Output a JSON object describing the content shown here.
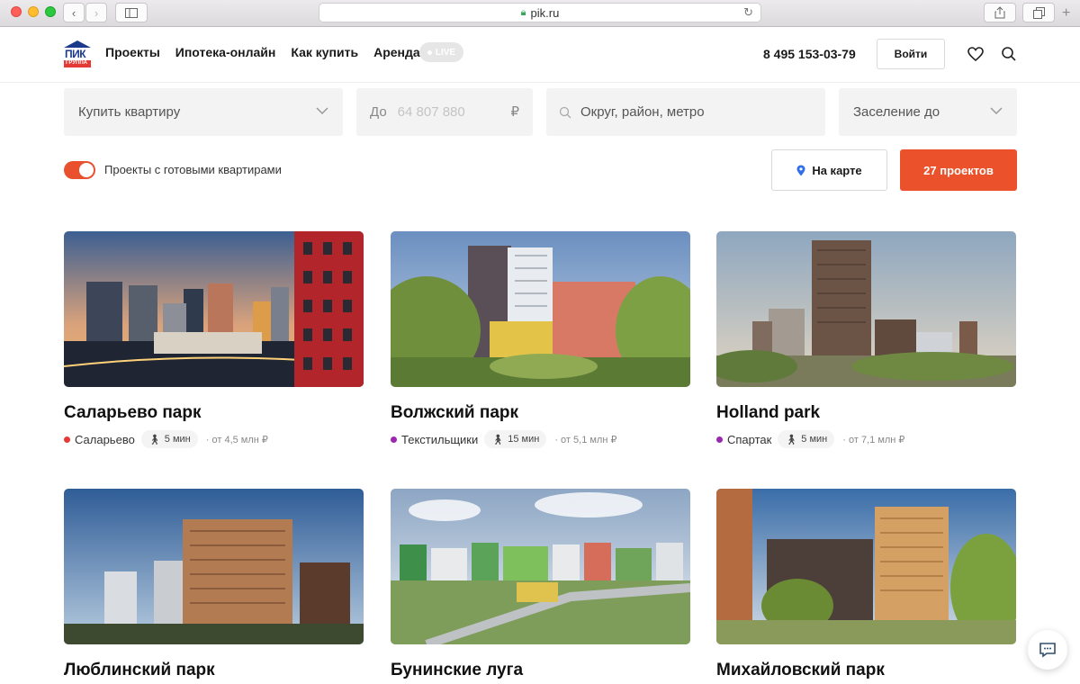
{
  "browser": {
    "url": "pik.ru"
  },
  "header": {
    "logo_top": "ПИК",
    "logo_bottom": "ГРУППА",
    "nav": [
      {
        "label": "Проекты"
      },
      {
        "label": "Ипотека-онлайн"
      },
      {
        "label": "Как купить"
      },
      {
        "label": "Аренда"
      }
    ],
    "live_label": "LIVE",
    "phone": "8 495 153-03-79",
    "login_label": "Войти"
  },
  "filters": {
    "type_select": "Купить квартиру",
    "price_prefix": "До",
    "price_placeholder": "64 807 880",
    "currency": "₽",
    "location_placeholder": "Округ, район, метро",
    "settle_select": "Заселение до",
    "ready_toggle_label": "Проекты с готовыми квартирами",
    "ready_toggle_on": true,
    "map_button": "На карте",
    "projects_button": "27 проектов"
  },
  "projects": [
    {
      "title": "Саларьево парк",
      "metro": "Саларьево",
      "metro_color": "#e53935",
      "walk": "5 мин",
      "price": "от 4,5 млн ₽"
    },
    {
      "title": "Волжский парк",
      "metro": "Текстильщики",
      "metro_color": "#9c27b0",
      "walk": "15 мин",
      "price": "от 5,1 млн ₽"
    },
    {
      "title": "Holland park",
      "metro": "Спартак",
      "metro_color": "#9c27b0",
      "walk": "5 мин",
      "price": "от 7,1 млн ₽"
    },
    {
      "title": "Люблинский парк"
    },
    {
      "title": "Бунинские луга"
    },
    {
      "title": "Михайловский парк"
    }
  ],
  "colors": {
    "accent": "#eb512b",
    "brand_blue": "#1b3a8c"
  }
}
